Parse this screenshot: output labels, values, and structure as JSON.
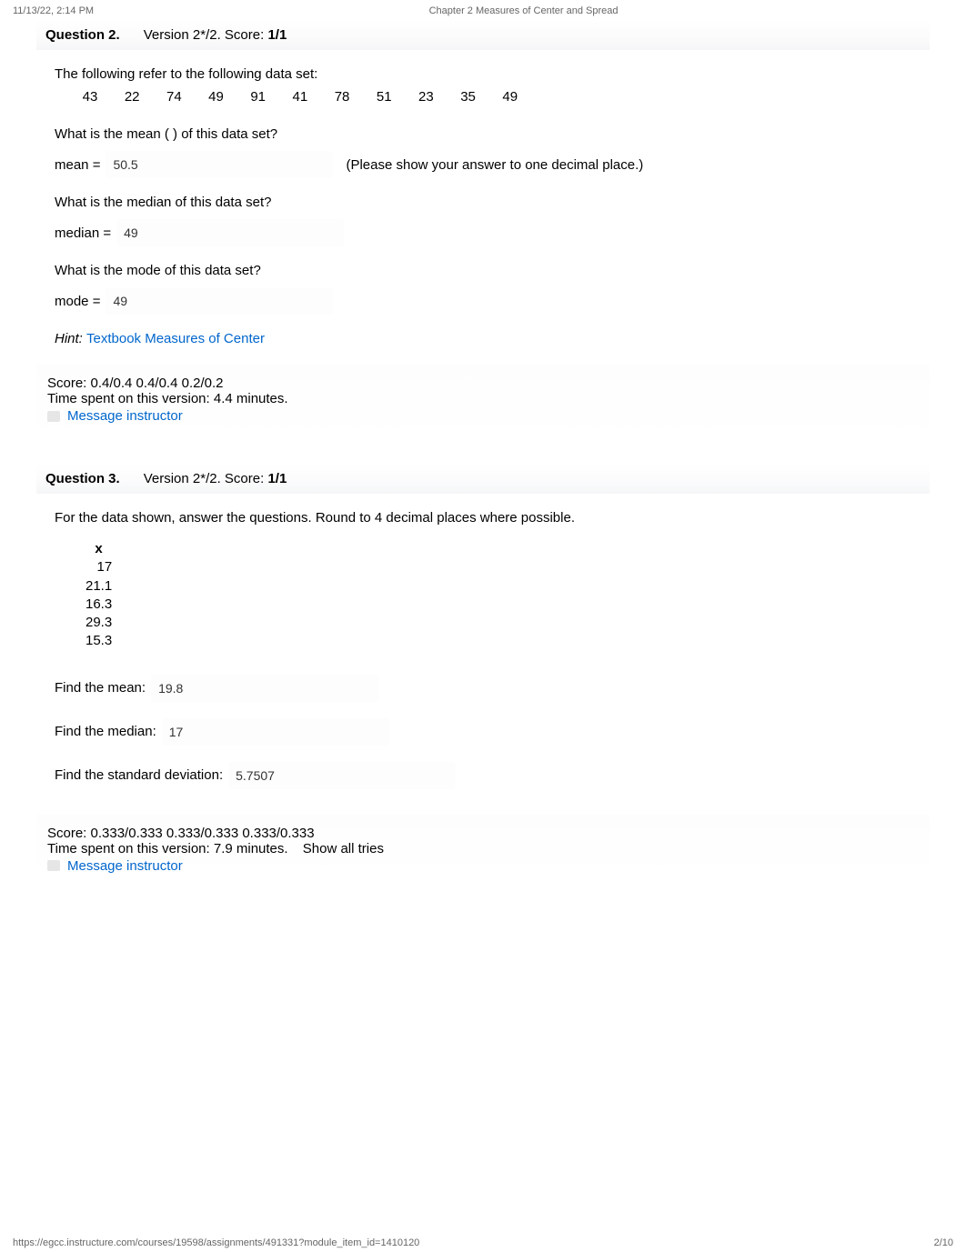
{
  "print": {
    "datetime": "11/13/22, 2:14 PM",
    "title": "Chapter 2 Measures of Center and Spread",
    "url": "https://egcc.instructure.com/courses/19598/assignments/491331?module_item_id=1410120",
    "page_num": "2/10"
  },
  "q2": {
    "label": "Question 2.",
    "version": "Version 2*/2. Score: ",
    "score": "1/1",
    "intro": "The following refer to the following data set:",
    "dataset": [
      "43",
      "22",
      "74",
      "49",
      "91",
      "41",
      "78",
      "51",
      "23",
      "35",
      "49"
    ],
    "mean_prompt": "What is the mean ( ) of this data set?",
    "mean_label": "mean = ",
    "mean_value": "50.5",
    "mean_note": "(Please show your answer to one decimal place.)",
    "median_prompt": "What is the median of this data set?",
    "median_label": "median = ",
    "median_value": "49",
    "mode_prompt": "What is the mode of this data set?",
    "mode_label": "mode = ",
    "mode_value": "49",
    "hint_label": "Hint: ",
    "hint_link": "Textbook Measures of Center",
    "score_line": "Score: 0.4/0.4 0.4/0.4 0.2/0.2",
    "time_line": "Time spent on this version: 4.4 minutes.",
    "msg_link": "Message instructor"
  },
  "q3": {
    "label": "Question 3.",
    "version": "Version 2*/2. Score: ",
    "score": "1/1",
    "intro": "For the data shown, answer the questions. Round to 4 decimal places where possible.",
    "x_header": "x",
    "x_values": [
      "17",
      "21.1",
      "16.3",
      "29.3",
      "15.3"
    ],
    "mean_label": "Find the mean: ",
    "mean_value": "19.8",
    "median_label": "Find the median: ",
    "median_value": "17",
    "sd_label": "Find the standard deviation: ",
    "sd_value": "5.7507",
    "score_line": "Score: 0.333/0.333 0.333/0.333 0.333/0.333",
    "time_line": "Time spent on this version: 7.9 minutes.",
    "show_all": "Show all tries",
    "msg_link": "Message instructor"
  }
}
